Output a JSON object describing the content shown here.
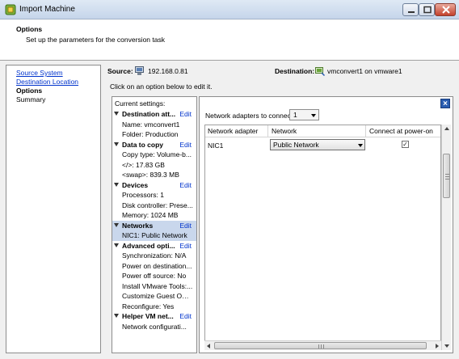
{
  "window": {
    "title": "Import Machine",
    "icon": "vmware-converter-icon"
  },
  "header": {
    "title": "Options",
    "subtitle": "Set up the parameters for the conversion task"
  },
  "nav": {
    "items": [
      {
        "label": "Source System",
        "state": "link"
      },
      {
        "label": "Destination Location",
        "state": "link"
      },
      {
        "label": "Options",
        "state": "current"
      },
      {
        "label": "Summary",
        "state": "plain"
      }
    ]
  },
  "source": {
    "label": "Source:",
    "value": "192.168.0.81",
    "icon": "physical-machine-icon"
  },
  "destination": {
    "label": "Destination:",
    "value": "vmconvert1 on vmware1",
    "icon": "virtual-machine-icon"
  },
  "instruction": "Click on an option below to edit it.",
  "settings": {
    "header": "Current settings:",
    "edit_label": "Edit",
    "sections": [
      {
        "title": "Destination att...",
        "items": [
          "Name: vmconvert1",
          "Folder: Production"
        ]
      },
      {
        "title": "Data to copy",
        "items": [
          "Copy type: Volume-b...",
          "</>: 17.83 GB",
          "<swap>: 839.3 MB"
        ]
      },
      {
        "title": "Devices",
        "items": [
          "Processors: 1",
          "Disk controller: Prese...",
          "Memory: 1024 MB"
        ]
      },
      {
        "title": "Networks",
        "items": [
          "NIC1: Public Network"
        ],
        "selected": true
      },
      {
        "title": "Advanced opti...",
        "items": [
          "Synchronization: N/A",
          "Power on destination...",
          "Power off source: No",
          "Install VMware Tools:...",
          "Customize Guest OS:...",
          "Reconfigure: Yes"
        ]
      },
      {
        "title": "Helper VM net...",
        "items": [
          "Network configurati..."
        ]
      }
    ]
  },
  "network_panel": {
    "adapters_label": "Network adapters to connect",
    "adapters_value": "1",
    "columns": [
      "Network adapter",
      "Network",
      "Connect at power-on"
    ],
    "rows": [
      {
        "adapter": "NIC1",
        "network": "Public Network",
        "connect": true
      }
    ],
    "close_glyph": "×"
  },
  "colors": {
    "link": "#0033cc",
    "selection": "#c9d7ec",
    "close_button": "#2a5db0"
  }
}
